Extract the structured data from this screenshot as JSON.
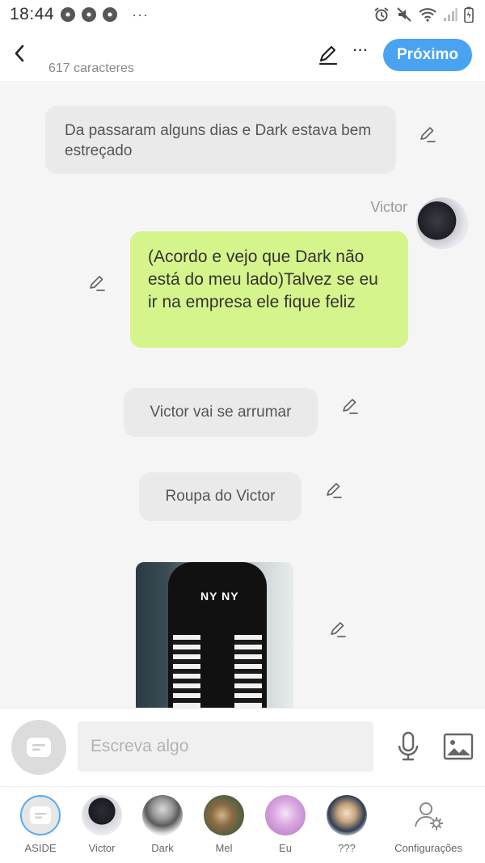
{
  "status_bar": {
    "time": "18:44",
    "more": "···"
  },
  "header": {
    "char_count": "617 caracteres",
    "more": "···",
    "next_label": "Próximo"
  },
  "messages": [
    {
      "type": "narration",
      "text": "Da passaram alguns dias e Dark estava bem estreçado"
    },
    {
      "type": "speech",
      "speaker": "Victor",
      "text": "(Acordo e vejo que Dark não está do meu lado)Talvez se eu ir na empresa ele fique feliz"
    },
    {
      "type": "narration",
      "text": "Victor vai se arrumar"
    },
    {
      "type": "narration",
      "text": "Roupa do Victor"
    },
    {
      "type": "image",
      "print_text": "NY NY"
    }
  ],
  "input_bar": {
    "placeholder": "Escreva algo"
  },
  "characters": [
    {
      "label": "ASIDE",
      "avatar": "aside-icon"
    },
    {
      "label": "Victor"
    },
    {
      "label": "Dark"
    },
    {
      "label": "Mel"
    },
    {
      "label": "Eu"
    },
    {
      "label": "???"
    },
    {
      "label": "Configurações",
      "icon": "settings-icon"
    }
  ],
  "colors": {
    "accent": "#4aa3f0",
    "speech_bubble": "#d6f48c",
    "narration_bubble": "#eaeaea",
    "background": "#f5f5f5"
  }
}
